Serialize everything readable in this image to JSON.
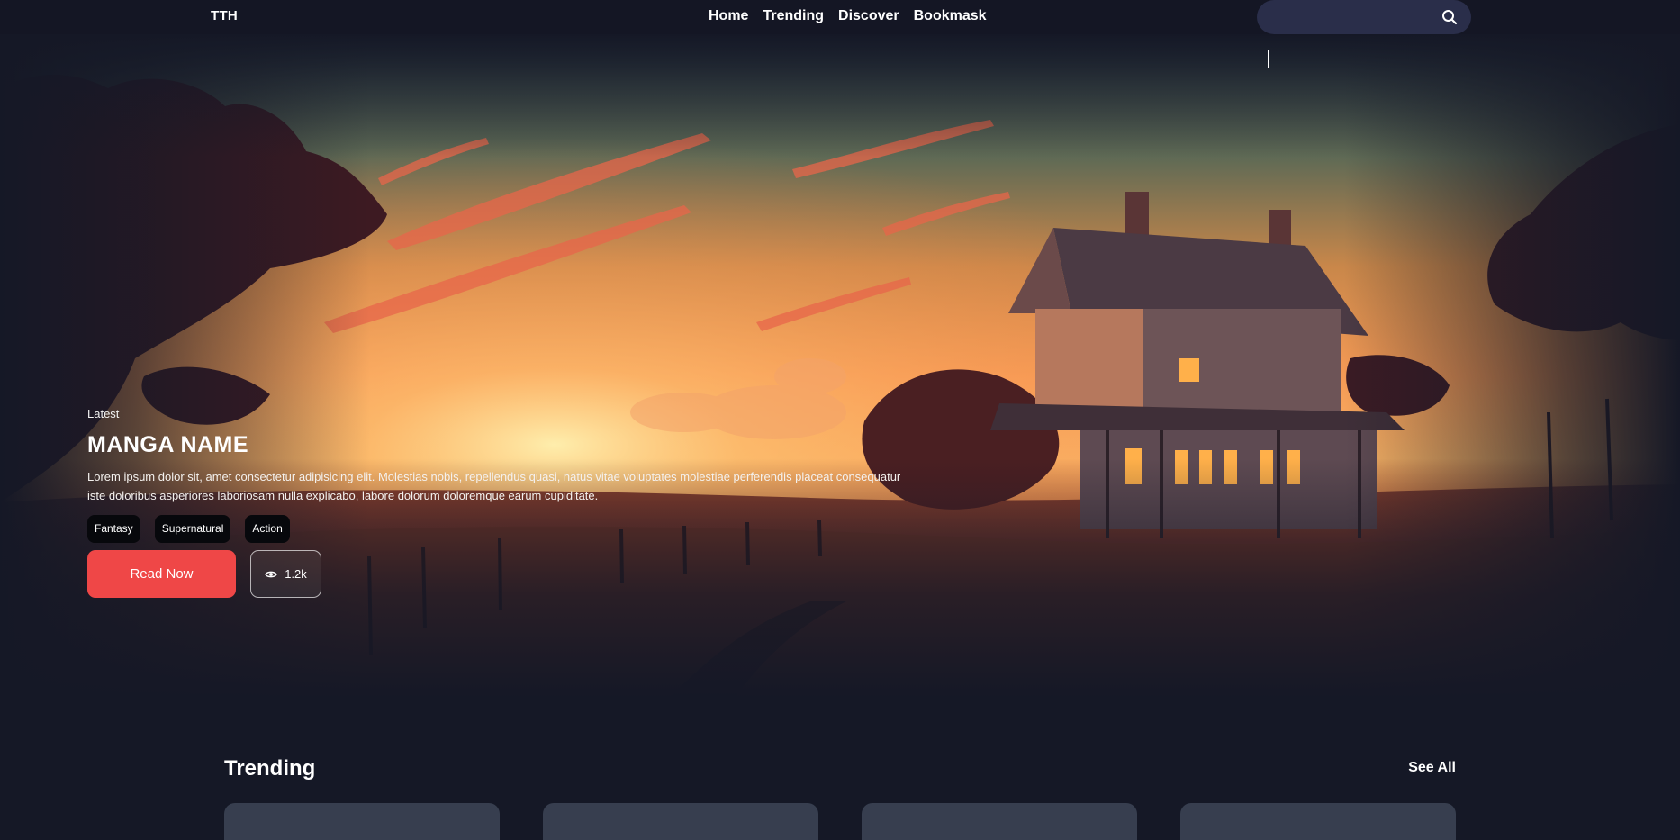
{
  "nav": {
    "logo": "TTH",
    "links": [
      "Home",
      "Trending",
      "Discover",
      "Bookmask"
    ],
    "search_placeholder": "",
    "icon": "search-icon"
  },
  "hero": {
    "label": "Latest",
    "title": "MANGA NAME",
    "description": "Lorem ipsum dolor sit, amet consectetur adipisicing elit. Molestias nobis, repellendus quasi, natus vitae voluptates molestiae perferendis placeat consequatur iste doloribus asperiores laboriosam nulla explicabo, labore dolorum doloremque earum cupiditate.",
    "tags": [
      "Fantasy",
      "Supernatural",
      "Action"
    ],
    "read_button": "Read Now",
    "views": "1.2k",
    "views_icon": "eye-icon"
  },
  "trending": {
    "title": "Trending",
    "see_all": "See All",
    "card_count": 4
  },
  "colors": {
    "background": "#151826",
    "accent": "#ef4747",
    "search_bg": "#2a2e4a",
    "tag_bg": "#07080c",
    "card_bg": "#373e4f"
  }
}
